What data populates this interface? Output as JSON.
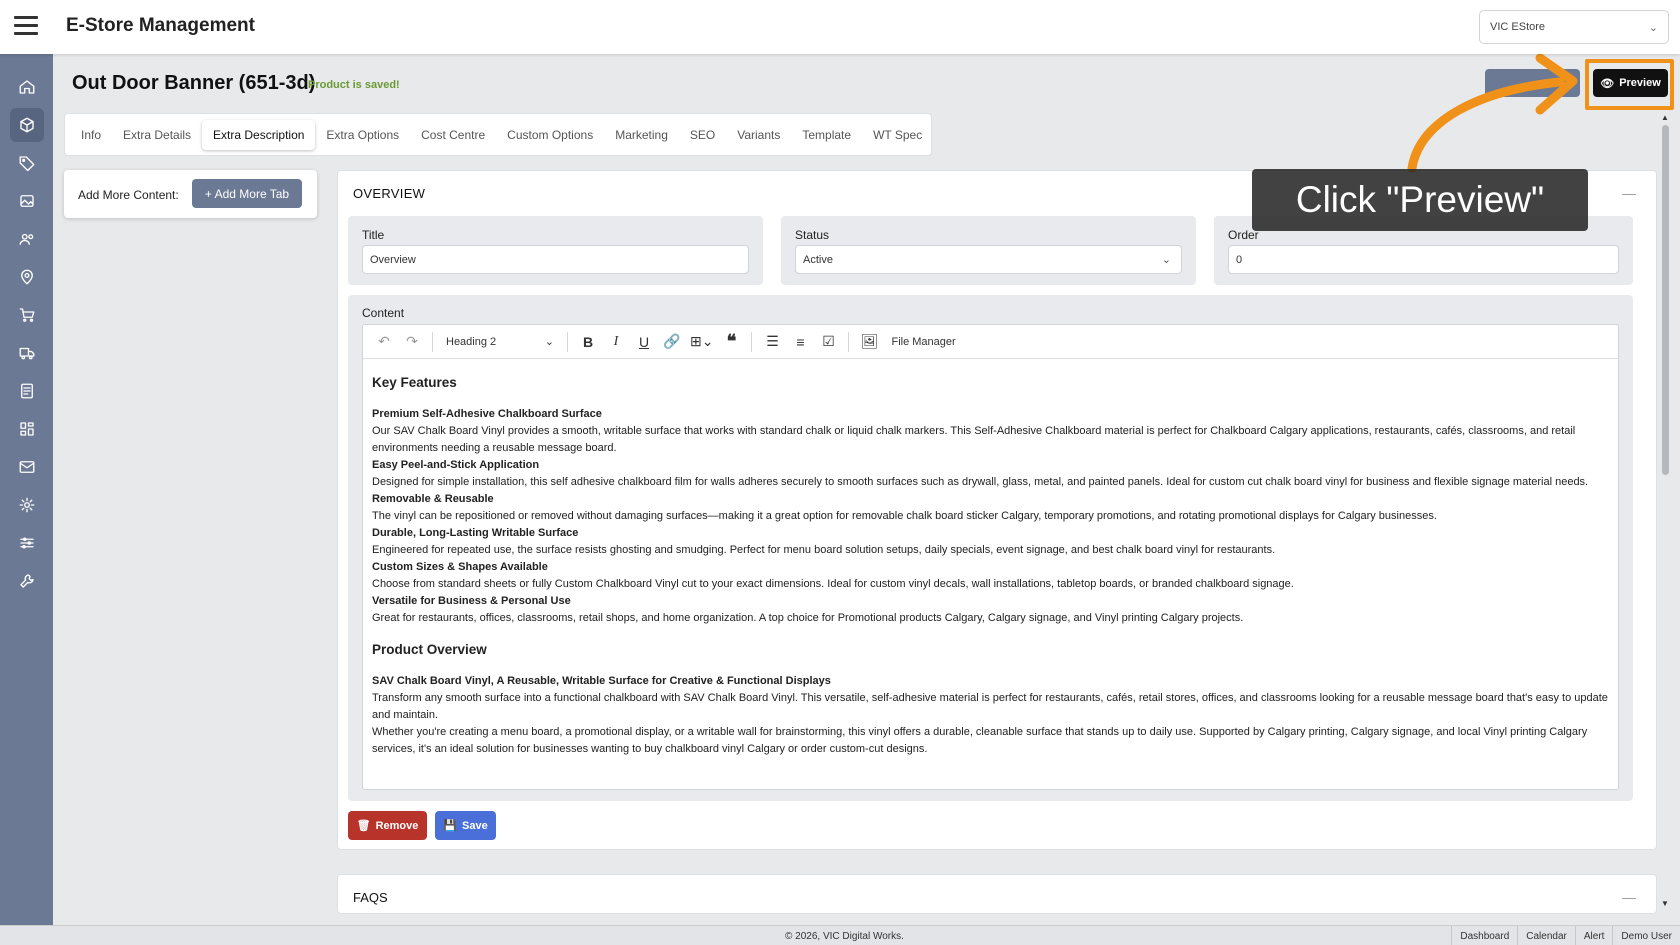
{
  "app": {
    "title": "E-Store Management",
    "store_selected": "VIC EStore"
  },
  "page": {
    "title": "Out Door Banner (651-3d)",
    "saved_note": "Product is saved!",
    "preview_label": "Preview"
  },
  "tabs": [
    {
      "label": "Info"
    },
    {
      "label": "Extra Details"
    },
    {
      "label": "Extra Description",
      "active": true
    },
    {
      "label": "Extra Options"
    },
    {
      "label": "Cost Centre"
    },
    {
      "label": "Custom Options"
    },
    {
      "label": "Marketing"
    },
    {
      "label": "SEO"
    },
    {
      "label": "Variants"
    },
    {
      "label": "Template"
    },
    {
      "label": "WT Spec"
    }
  ],
  "add_panel": {
    "label": "Add More Content:",
    "button": "+ Add More Tab"
  },
  "overview": {
    "title": "OVERVIEW",
    "fields": {
      "title_label": "Title",
      "title_value": "Overview",
      "status_label": "Status",
      "status_value": "Active",
      "order_label": "Order",
      "order_value": "0"
    },
    "content_label": "Content",
    "toolbar": {
      "heading": "Heading 2",
      "file_manager": "File Manager"
    },
    "heading1": "Key Features",
    "features": [
      {
        "title": "Premium Self-Adhesive Chalkboard Surface",
        "text": "Our SAV Chalk Board Vinyl provides a smooth, writable surface that works with standard chalk or liquid chalk markers. This Self-Adhesive Chalkboard material is perfect for Chalkboard Calgary applications, restaurants, cafés, classrooms, and retail environments needing a reusable message board."
      },
      {
        "title": "Easy Peel-and-Stick Application",
        "text": "Designed for simple installation, this self adhesive chalkboard film for walls adheres securely to smooth surfaces such as drywall, glass, metal, and painted panels. Ideal for custom cut chalk board vinyl for business and flexible signage material needs."
      },
      {
        "title": "Removable & Reusable",
        "text": "The vinyl can be repositioned or removed without damaging surfaces—making it a great option for removable chalk board sticker Calgary, temporary promotions, and rotating promotional displays for Calgary businesses."
      },
      {
        "title": "Durable, Long-Lasting Writable Surface",
        "text": "Engineered for repeated use, the surface resists ghosting and smudging. Perfect for menu board solution setups, daily specials, event signage, and best chalk board vinyl for restaurants."
      },
      {
        "title": "Custom Sizes & Shapes Available",
        "text": "Choose from standard sheets or fully Custom Chalkboard Vinyl cut to your exact dimensions. Ideal for custom vinyl decals, wall installations, tabletop boards, or branded chalkboard signage."
      },
      {
        "title": "Versatile for Business & Personal Use",
        "text": "Great for restaurants, offices, classrooms, retail shops, and home organization. A top choice for Promotional products Calgary, Calgary signage, and Vinyl printing Calgary projects."
      }
    ],
    "heading2": "Product Overview",
    "overview_sub": "SAV Chalk Board Vinyl, A Reusable, Writable Surface for Creative & Functional Displays",
    "overview_p1": "Transform any smooth surface into a functional chalkboard with SAV Chalk Board Vinyl. This versatile, self-adhesive material is perfect for restaurants, cafés, retail stores, offices, and classrooms looking for a reusable message board that's easy to update and maintain.",
    "overview_p2": "Whether you're creating a menu board, a promotional display, or a writable wall for brainstorming, this vinyl offers a durable, cleanable surface that stands up to daily use. Supported by Calgary printing, Calgary signage, and local Vinyl printing Calgary services, it's an ideal solution for businesses wanting to buy chalkboard vinyl Calgary or order custom-cut designs.",
    "remove_label": "Remove",
    "save_label": "Save"
  },
  "faqs": {
    "title": "FAQS"
  },
  "footer": {
    "copyright": "© 2026, VIC Digital Works.",
    "links": [
      "Dashboard",
      "Calendar",
      "Alert",
      "Demo User"
    ]
  },
  "callout": {
    "text": "Click \"Preview\"",
    "accent": "#f0921a"
  }
}
